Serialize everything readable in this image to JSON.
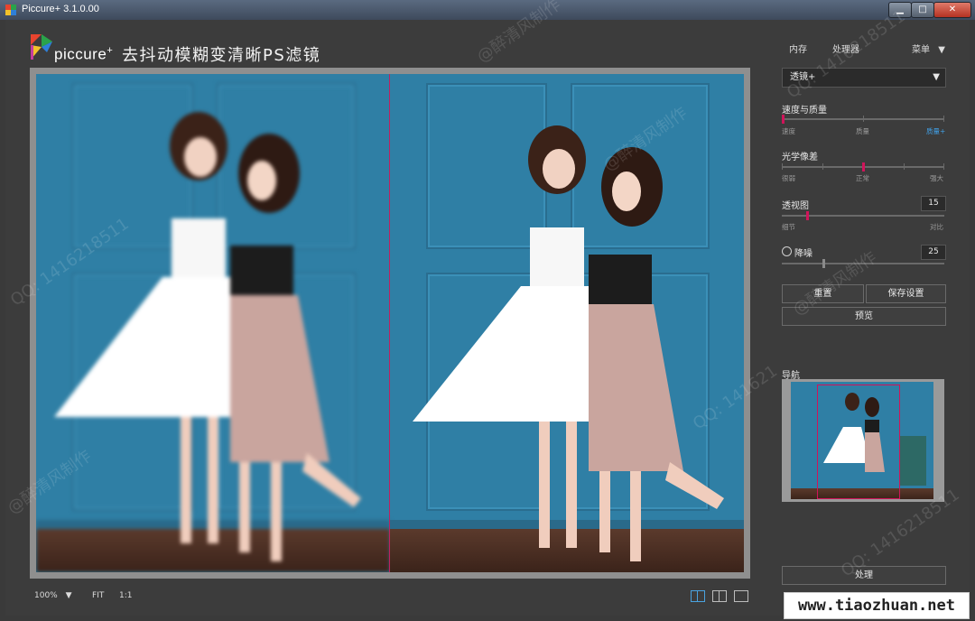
{
  "window": {
    "title": "Piccure+ 3.1.0.00",
    "min_symbol": "▁",
    "max_symbol": "□",
    "close_symbol": "✕"
  },
  "header": {
    "brand": "piccure",
    "brand_sup": "+",
    "subtitle": "去抖动模糊变清晰PS滤镜"
  },
  "top_menu": {
    "memory": "内存",
    "processor": "处理器",
    "menu": "菜单",
    "menu_arrow": "▼"
  },
  "lens_select": {
    "value": "透镜+",
    "arrow": "▼"
  },
  "speed_quality": {
    "label": "速度与质量",
    "ticks": [
      "速度",
      "质量",
      "质量+"
    ],
    "level": 0.0
  },
  "optical_aberration": {
    "label": "光学像差",
    "ticks": [
      "很弱",
      "正常",
      "强大"
    ],
    "level": 0.5
  },
  "perspective": {
    "label": "透视图",
    "value": "15",
    "ticks": [
      "细节",
      "对比"
    ],
    "level": 0.15
  },
  "denoise": {
    "label": "降噪",
    "value": "25",
    "level": 0.25
  },
  "buttons": {
    "reset": "重置",
    "save_settings": "保存设置",
    "preview": "预览",
    "process": "处理"
  },
  "navigator": {
    "label": "导航"
  },
  "statusbar": {
    "zoom": "100%",
    "zoom_arrow": "▼",
    "fit": "FIT",
    "one_to_one": "1:1"
  },
  "watermarks": {
    "qq": "QQ: 1416218511",
    "qq_short": "QQ: 141621",
    "maker": "@醉清风制作",
    "site": "www.tiaozhuan.net"
  },
  "colors": {
    "accent": "#d0145a",
    "active_blue": "#41a0e6",
    "background": "#3a3a3a"
  }
}
